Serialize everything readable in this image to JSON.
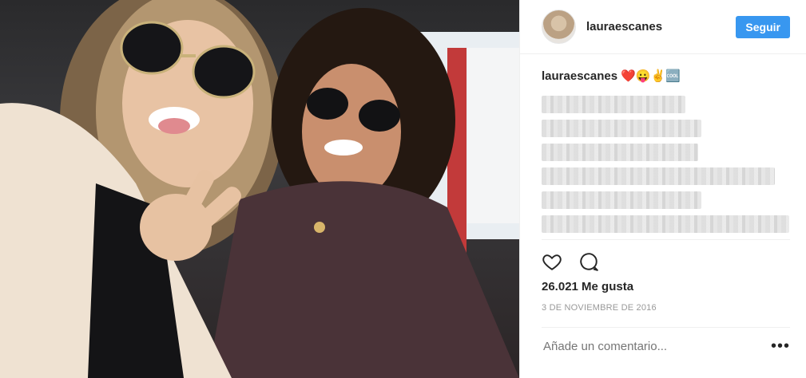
{
  "header": {
    "username": "lauraescanes",
    "follow_label": "Seguir"
  },
  "caption": {
    "username": "lauraescanes",
    "emojis": "❤️😛✌️🆒"
  },
  "stats": {
    "likes": "26.021 Me gusta",
    "date": "3 DE NOVIEMBRE DE 2016"
  },
  "comment": {
    "placeholder": "Añade un comentario...",
    "more_options": "•••"
  },
  "icons": {
    "like": "heart-icon",
    "comment": "comment-icon"
  }
}
